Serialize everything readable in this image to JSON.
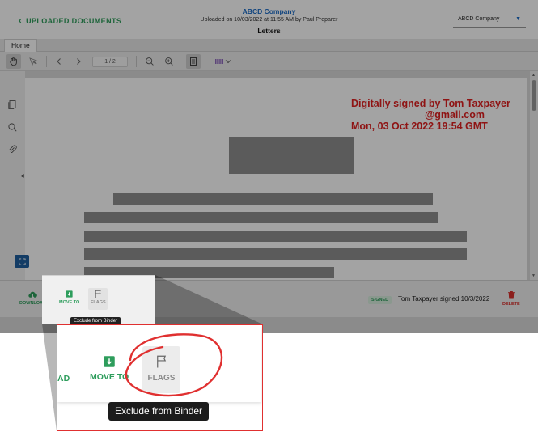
{
  "header": {
    "back_label": "UPLOADED DOCUMENTS",
    "company": "ABCD Company",
    "uploaded_line": "Uploaded on 10/03/2022 at 11:55 AM by Paul Preparer",
    "document_title": "Letters",
    "company_select": "ABCD Company"
  },
  "tabs": [
    {
      "label": "Home"
    }
  ],
  "toolbar": {
    "page_indicator": "1 / 2"
  },
  "document": {
    "signature_lines": [
      "Digitally signed by Tom Taxpayer",
      "@gmail.com",
      "Mon, 03 Oct 2022 19:54 GMT"
    ]
  },
  "actionbar": {
    "download_label": "DOWNLOAD",
    "move_to_label": "MOVE TO",
    "flags_label": "FLAGS",
    "signed_badge": "SIGNED",
    "signed_text": "Tom Taxpayer signed 10/3/2022",
    "delete_label": "DELETE",
    "tooltip": "Exclude from Binder"
  },
  "zoom": {
    "download_partial": "AD",
    "move_to_label": "MOVE TO",
    "flags_label": "FLAGS",
    "tooltip": "Exclude from Binder"
  },
  "colors": {
    "accent_green": "#2e9d5c",
    "link_blue": "#1c6cc7",
    "signature_red": "#e02020",
    "callout_red": "#e03030",
    "delete_red": "#d9302c"
  },
  "icons": [
    "chevron-left-icon",
    "chevron-down-icon",
    "hand-icon",
    "select-icon",
    "arrow-left-icon",
    "arrow-right-icon",
    "zoom-out-icon",
    "zoom-in-icon",
    "page-view-icon",
    "barcode-icon",
    "pages-icon",
    "search-icon",
    "paperclip-icon",
    "expand-icon",
    "download-icon",
    "move-to-icon",
    "flag-icon",
    "trash-icon"
  ]
}
